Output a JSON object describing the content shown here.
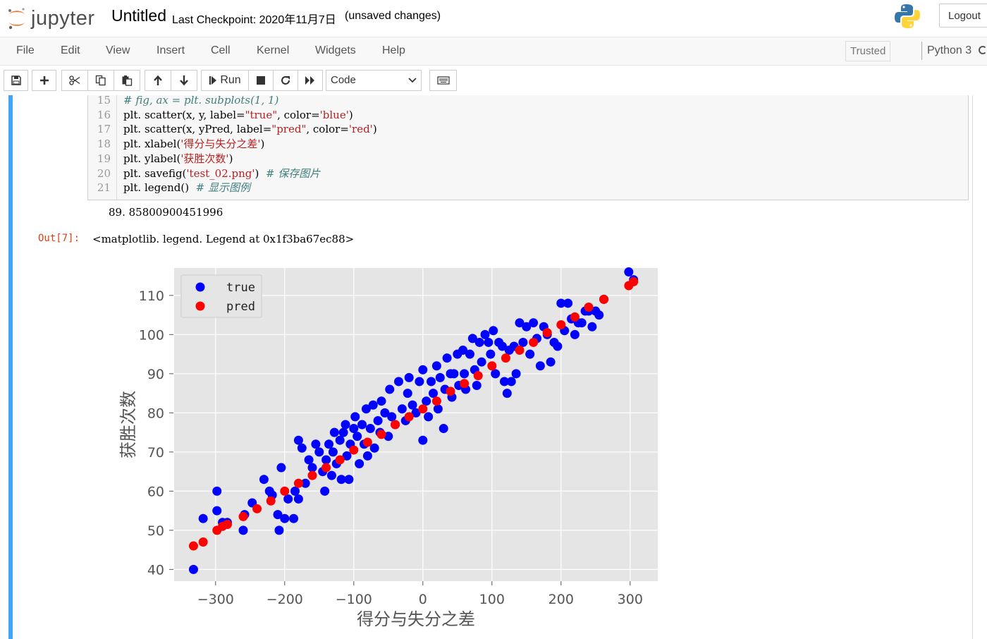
{
  "header": {
    "logo_text": "jupyter",
    "notebook_title": "Untitled",
    "checkpoint": "Last Checkpoint: 2020年11月7日",
    "unsaved": "(unsaved changes)",
    "logout_label": "Logout"
  },
  "menu": {
    "items": [
      "File",
      "Edit",
      "View",
      "Insert",
      "Cell",
      "Kernel",
      "Widgets",
      "Help"
    ],
    "trusted_label": "Trusted",
    "kernel_name": "Python 3"
  },
  "toolbar": {
    "run_label": "Run",
    "cell_type": "Code",
    "icons": [
      "save-icon",
      "plus-icon",
      "cut-icon",
      "copy-icon",
      "paste-icon",
      "arrow-up-icon",
      "arrow-down-icon",
      "run-icon",
      "stop-icon",
      "restart-icon",
      "fast-forward-icon",
      "keyboard-icon"
    ]
  },
  "code": {
    "lines": [
      {
        "num": "15",
        "html": "<span class=\"cmt\"># fig, ax = plt. subplots(1, 1)</span>"
      },
      {
        "num": "16",
        "html": "plt. scatter(x, y, label=<span class=\"str\">\"true\"</span>, color=<span class=\"str\">'blue'</span>)"
      },
      {
        "num": "17",
        "html": "plt. scatter(x, yPred, label=<span class=\"str\">\"pred\"</span>, color=<span class=\"str\">'red'</span>)"
      },
      {
        "num": "18",
        "html": "plt. xlabel(<span class=\"str\">'得分与失分之差'</span>)"
      },
      {
        "num": "19",
        "html": "plt. ylabel(<span class=\"str\">'获胜次数'</span>)"
      },
      {
        "num": "20",
        "html": "plt. savefig(<span class=\"str\">'test_02.png'</span>)  <span class=\"cmt\"># 保存图片</span>"
      },
      {
        "num": "21",
        "html": "plt. legend()  <span class=\"cmt\"># 显示图例</span>"
      }
    ]
  },
  "output": {
    "stdout": "89. 85800900451996",
    "prompt": "Out[7]:",
    "repr": "<matplotlib. legend. Legend at 0x1f3ba67ec88>"
  },
  "chart_data": {
    "type": "scatter",
    "xlabel": "得分与失分之差",
    "ylabel": "获胜次数",
    "xlim": [
      -360,
      340
    ],
    "ylim": [
      37,
      117
    ],
    "xticks": [
      -300,
      -200,
      -100,
      0,
      100,
      200,
      300
    ],
    "yticks": [
      40,
      50,
      60,
      70,
      80,
      90,
      100,
      110
    ],
    "grid": true,
    "legend_position": "upper left",
    "series": [
      {
        "name": "true",
        "color": "#0000ff",
        "points": [
          [
            -332,
            40
          ],
          [
            -318,
            53
          ],
          [
            -298,
            60
          ],
          [
            -298,
            55
          ],
          [
            -290,
            52
          ],
          [
            -283,
            52
          ],
          [
            -260,
            50
          ],
          [
            -258,
            54
          ],
          [
            -247,
            57
          ],
          [
            -230,
            63
          ],
          [
            -222,
            60
          ],
          [
            -218,
            59
          ],
          [
            -210,
            54
          ],
          [
            -208,
            50
          ],
          [
            -205,
            66
          ],
          [
            -200,
            53
          ],
          [
            -195,
            58
          ],
          [
            -187,
            53
          ],
          [
            -185,
            60
          ],
          [
            -180,
            58
          ],
          [
            -180,
            73
          ],
          [
            -175,
            71
          ],
          [
            -170,
            62
          ],
          [
            -165,
            68
          ],
          [
            -160,
            66
          ],
          [
            -155,
            72
          ],
          [
            -150,
            70
          ],
          [
            -145,
            65
          ],
          [
            -142,
            60
          ],
          [
            -140,
            68
          ],
          [
            -136,
            72
          ],
          [
            -132,
            64
          ],
          [
            -130,
            70
          ],
          [
            -128,
            75
          ],
          [
            -125,
            67
          ],
          [
            -120,
            73
          ],
          [
            -118,
            63
          ],
          [
            -115,
            75
          ],
          [
            -112,
            77
          ],
          [
            -110,
            69
          ],
          [
            -107,
            63
          ],
          [
            -105,
            72
          ],
          [
            -100,
            76
          ],
          [
            -98,
            79
          ],
          [
            -95,
            74
          ],
          [
            -92,
            67
          ],
          [
            -88,
            77
          ],
          [
            -85,
            72
          ],
          [
            -82,
            81
          ],
          [
            -80,
            69
          ],
          [
            -76,
            76
          ],
          [
            -72,
            82
          ],
          [
            -70,
            71
          ],
          [
            -65,
            78
          ],
          [
            -62,
            75
          ],
          [
            -60,
            83
          ],
          [
            -55,
            80
          ],
          [
            -50,
            74
          ],
          [
            -48,
            86
          ],
          [
            -45,
            79
          ],
          [
            -40,
            77
          ],
          [
            -35,
            88
          ],
          [
            -30,
            81
          ],
          [
            -25,
            78
          ],
          [
            -22,
            85
          ],
          [
            -20,
            89
          ],
          [
            -15,
            82
          ],
          [
            -10,
            80
          ],
          [
            -5,
            88
          ],
          [
            0,
            91
          ],
          [
            0,
            73
          ],
          [
            5,
            83
          ],
          [
            8,
            79
          ],
          [
            12,
            88
          ],
          [
            15,
            85
          ],
          [
            20,
            92
          ],
          [
            22,
            81
          ],
          [
            25,
            89
          ],
          [
            30,
            76
          ],
          [
            32,
            86
          ],
          [
            35,
            94
          ],
          [
            40,
            90
          ],
          [
            42,
            84
          ],
          [
            45,
            90
          ],
          [
            50,
            95
          ],
          [
            52,
            87
          ],
          [
            58,
            96
          ],
          [
            60,
            90
          ],
          [
            62,
            86
          ],
          [
            68,
            95
          ],
          [
            72,
            99
          ],
          [
            75,
            91
          ],
          [
            78,
            87
          ],
          [
            82,
            98
          ],
          [
            85,
            93
          ],
          [
            90,
            100
          ],
          [
            95,
            98
          ],
          [
            98,
            95
          ],
          [
            102,
            101
          ],
          [
            105,
            90
          ],
          [
            110,
            98
          ],
          [
            115,
            97
          ],
          [
            118,
            88
          ],
          [
            122,
            85
          ],
          [
            125,
            96
          ],
          [
            128,
            88
          ],
          [
            132,
            97
          ],
          [
            135,
            90
          ],
          [
            140,
            103
          ],
          [
            145,
            98
          ],
          [
            150,
            102
          ],
          [
            155,
            95
          ],
          [
            160,
            103
          ],
          [
            165,
            99
          ],
          [
            170,
            92
          ],
          [
            175,
            102
          ],
          [
            180,
            100
          ],
          [
            185,
            93
          ],
          [
            190,
            98
          ],
          [
            195,
            97
          ],
          [
            200,
            108
          ],
          [
            205,
            101
          ],
          [
            210,
            108
          ],
          [
            215,
            104
          ],
          [
            220,
            100
          ],
          [
            225,
            103
          ],
          [
            230,
            103
          ],
          [
            235,
            106
          ],
          [
            240,
            106
          ],
          [
            245,
            102
          ],
          [
            250,
            106
          ],
          [
            255,
            105
          ],
          [
            262,
            109
          ],
          [
            298,
            116
          ],
          [
            305,
            114
          ]
        ]
      },
      {
        "name": "pred",
        "color": "#ff0000",
        "points": [
          [
            -332,
            46
          ],
          [
            -318,
            47
          ],
          [
            -298,
            50
          ],
          [
            -290,
            51
          ],
          [
            -283,
            51.5
          ],
          [
            -260,
            53.5
          ],
          [
            -240,
            55.5
          ],
          [
            -220,
            57.5
          ],
          [
            -200,
            60
          ],
          [
            -180,
            62
          ],
          [
            -160,
            64
          ],
          [
            -140,
            66
          ],
          [
            -120,
            68
          ],
          [
            -100,
            70.5
          ],
          [
            -80,
            72.5
          ],
          [
            -60,
            74.5
          ],
          [
            -40,
            77
          ],
          [
            -20,
            79
          ],
          [
            0,
            81
          ],
          [
            20,
            83
          ],
          [
            40,
            85.5
          ],
          [
            60,
            87.5
          ],
          [
            80,
            89.5
          ],
          [
            100,
            92
          ],
          [
            120,
            94
          ],
          [
            140,
            96
          ],
          [
            160,
            98
          ],
          [
            180,
            100.5
          ],
          [
            200,
            102.5
          ],
          [
            220,
            104.5
          ],
          [
            240,
            107
          ],
          [
            262,
            109
          ],
          [
            298,
            112.5
          ],
          [
            305,
            113.5
          ]
        ]
      }
    ]
  }
}
